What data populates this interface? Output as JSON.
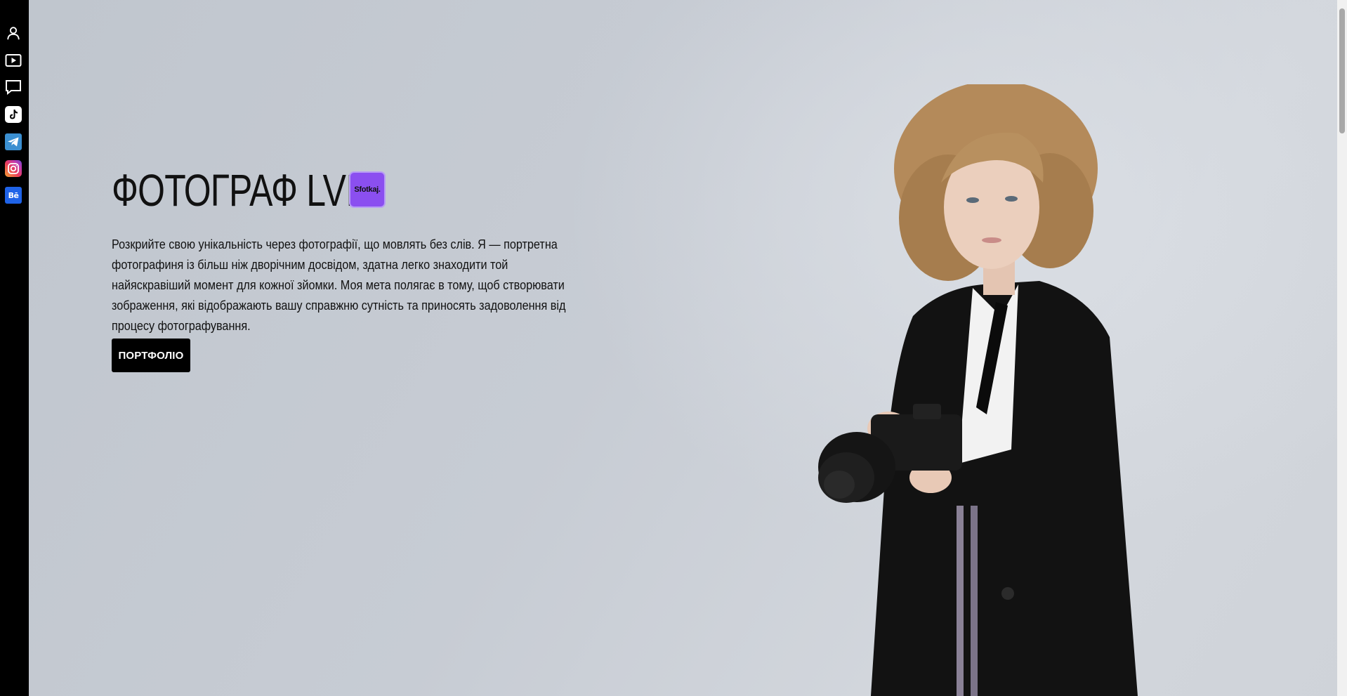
{
  "sidebar": {
    "icons": [
      {
        "name": "user-icon",
        "label": "Profile"
      },
      {
        "name": "video-icon",
        "label": "Video"
      },
      {
        "name": "chat-icon",
        "label": "Messages"
      },
      {
        "name": "tiktok-icon",
        "label": "TikTok"
      },
      {
        "name": "telegram-icon",
        "label": "Telegram"
      },
      {
        "name": "instagram-icon",
        "label": "Instagram"
      },
      {
        "name": "behance-icon",
        "label": "Bē"
      }
    ]
  },
  "hero": {
    "title": "ФОТОГРАФ LVIV",
    "logo_text": "Sfotkaj.",
    "description": "Розкрийте свою унікальність через фотографії, що мовлять без слів. Я — портретна фотографиня із більш ніж дворічним досвідом, здатна легко знаходити той найяскравіший момент для кожної зйомки. Моя мета полягає в тому, щоб створювати зображення, які відображають вашу справжню сутність та приносять задоволення від процесу фотографування.",
    "cta_label": "ПОРТФОЛІО"
  },
  "colors": {
    "sidebar_bg": "#000000",
    "page_bg": "#c6cbd3",
    "logo_bg": "#8b4ff0",
    "button_bg": "#000000",
    "button_text": "#ffffff"
  }
}
